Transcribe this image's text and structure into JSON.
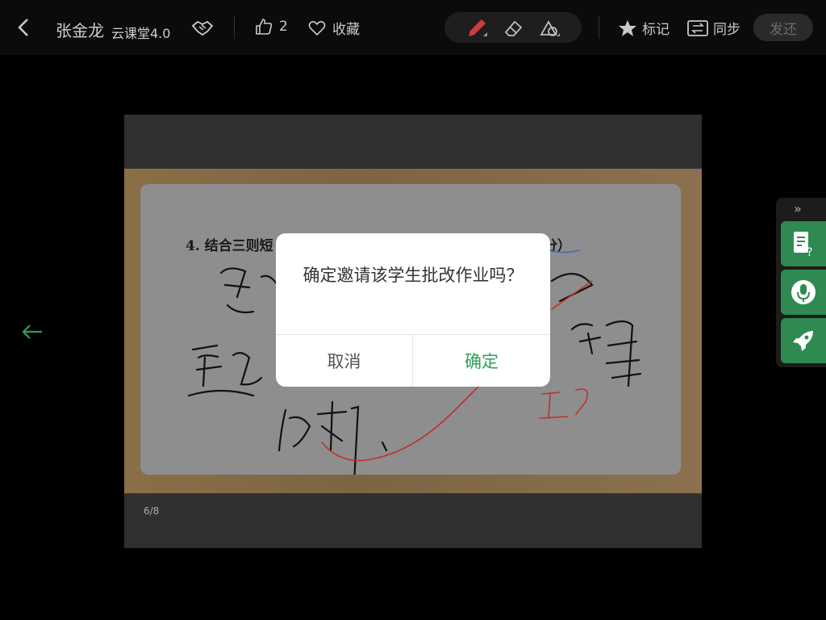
{
  "header": {
    "student_name": "张金龙",
    "course": "云课堂4.0",
    "like_count": "2",
    "favorite_label": "收藏",
    "mark_label": "标记",
    "sync_label": "同步",
    "send_label": "发还"
  },
  "worksheet": {
    "question_text": "4. 结合三则短",
    "question_suffix": "分）",
    "page_indicator": "6/8"
  },
  "side_panel": {
    "expand_label": "»"
  },
  "dialog": {
    "message": "确定邀请该学生批改作业吗？",
    "cancel_label": "取消",
    "confirm_label": "确定"
  },
  "colors": {
    "accent": "#2e9d5b",
    "side_button": "#2e8a50",
    "correction_ink": "#c0302b"
  }
}
